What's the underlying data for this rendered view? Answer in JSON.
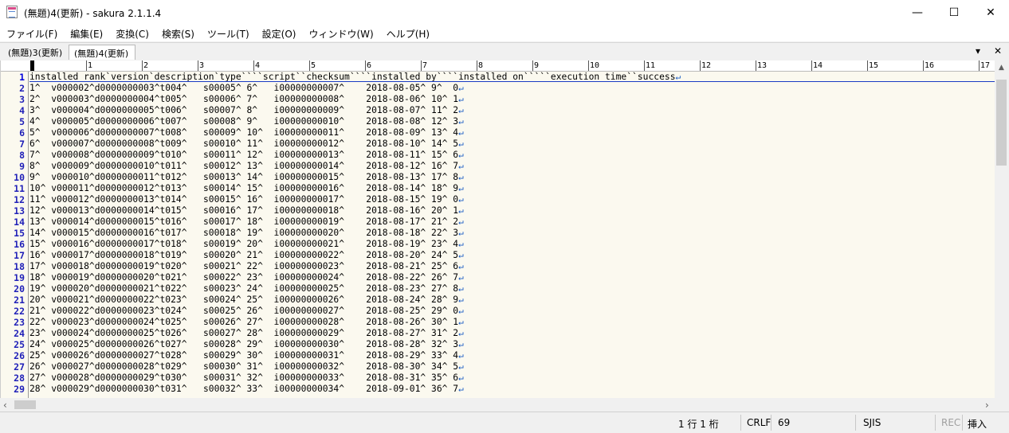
{
  "window": {
    "title": "(無題)4(更新) - sakura 2.1.1.4",
    "minimize_glyph": "—",
    "maximize_glyph": "☐",
    "close_glyph": "✕"
  },
  "menu": [
    "ファイル(F)",
    "編集(E)",
    "変換(C)",
    "検索(S)",
    "ツール(T)",
    "設定(O)",
    "ウィンドウ(W)",
    "ヘルプ(H)"
  ],
  "tabs": [
    {
      "label": "(無題)3(更新)",
      "active": false
    },
    {
      "label": "(無題)4(更新)",
      "active": true
    }
  ],
  "tab_controls": {
    "list_glyph": "▾",
    "close_glyph": "✕"
  },
  "ruler": [
    "1",
    "2",
    "3",
    "4",
    "5",
    "6",
    "7",
    "8",
    "9",
    "10",
    "11",
    "12",
    "13",
    "14",
    "15",
    "16",
    "17"
  ],
  "editor": {
    "eol_glyph": "↵",
    "lines": [
      "installed_rank`version`description`type````script``checksum````installed_by````installed_on`````execution_time``success",
      "1^  v000002^d0000000003^t004^   s00005^ 6^   i00000000007^    2018-08-05^ 9^  0",
      "2^  v000003^d0000000004^t005^   s00006^ 7^   i00000000008^    2018-08-06^ 10^ 1",
      "3^  v000004^d0000000005^t006^   s00007^ 8^   i00000000009^    2018-08-07^ 11^ 2",
      "4^  v000005^d0000000006^t007^   s00008^ 9^   i00000000010^    2018-08-08^ 12^ 3",
      "5^  v000006^d0000000007^t008^   s00009^ 10^  i00000000011^    2018-08-09^ 13^ 4",
      "6^  v000007^d0000000008^t009^   s00010^ 11^  i00000000012^    2018-08-10^ 14^ 5",
      "7^  v000008^d0000000009^t010^   s00011^ 12^  i00000000013^    2018-08-11^ 15^ 6",
      "8^  v000009^d0000000010^t011^   s00012^ 13^  i00000000014^    2018-08-12^ 16^ 7",
      "9^  v000010^d0000000011^t012^   s00013^ 14^  i00000000015^    2018-08-13^ 17^ 8",
      "10^ v000011^d0000000012^t013^   s00014^ 15^  i00000000016^    2018-08-14^ 18^ 9",
      "11^ v000012^d0000000013^t014^   s00015^ 16^  i00000000017^    2018-08-15^ 19^ 0",
      "12^ v000013^d0000000014^t015^   s00016^ 17^  i00000000018^    2018-08-16^ 20^ 1",
      "13^ v000014^d0000000015^t016^   s00017^ 18^  i00000000019^    2018-08-17^ 21^ 2",
      "14^ v000015^d0000000016^t017^   s00018^ 19^  i00000000020^    2018-08-18^ 22^ 3",
      "15^ v000016^d0000000017^t018^   s00019^ 20^  i00000000021^    2018-08-19^ 23^ 4",
      "16^ v000017^d0000000018^t019^   s00020^ 21^  i00000000022^    2018-08-20^ 24^ 5",
      "17^ v000018^d0000000019^t020^   s00021^ 22^  i00000000023^    2018-08-21^ 25^ 6",
      "18^ v000019^d0000000020^t021^   s00022^ 23^  i00000000024^    2018-08-22^ 26^ 7",
      "19^ v000020^d0000000021^t022^   s00023^ 24^  i00000000025^    2018-08-23^ 27^ 8",
      "20^ v000021^d0000000022^t023^   s00024^ 25^  i00000000026^    2018-08-24^ 28^ 9",
      "21^ v000022^d0000000023^t024^   s00025^ 26^  i00000000027^    2018-08-25^ 29^ 0",
      "22^ v000023^d0000000024^t025^   s00026^ 27^  i00000000028^    2018-08-26^ 30^ 1",
      "23^ v000024^d0000000025^t026^   s00027^ 28^  i00000000029^    2018-08-27^ 31^ 2",
      "24^ v000025^d0000000026^t027^   s00028^ 29^  i00000000030^    2018-08-28^ 32^ 3",
      "25^ v000026^d0000000027^t028^   s00029^ 30^  i00000000031^    2018-08-29^ 33^ 4",
      "26^ v000027^d0000000028^t029^   s00030^ 31^  i00000000032^    2018-08-30^ 34^ 5",
      "27^ v000028^d0000000029^t030^   s00031^ 32^  i00000000033^    2018-08-31^ 35^ 6",
      "28^ v000029^d0000000030^t031^   s00032^ 33^  i00000000034^    2018-09-01^ 36^ 7"
    ]
  },
  "status": {
    "position": "1 行   1 桁",
    "eol": "CRLF",
    "code": "69",
    "encoding": "SJIS",
    "rec": "REC",
    "mode": "挿入"
  },
  "colors": {
    "line_number": "#1f1fb8",
    "eol_mark": "#1a5cc4",
    "editor_bg": "#fbf9ef"
  }
}
